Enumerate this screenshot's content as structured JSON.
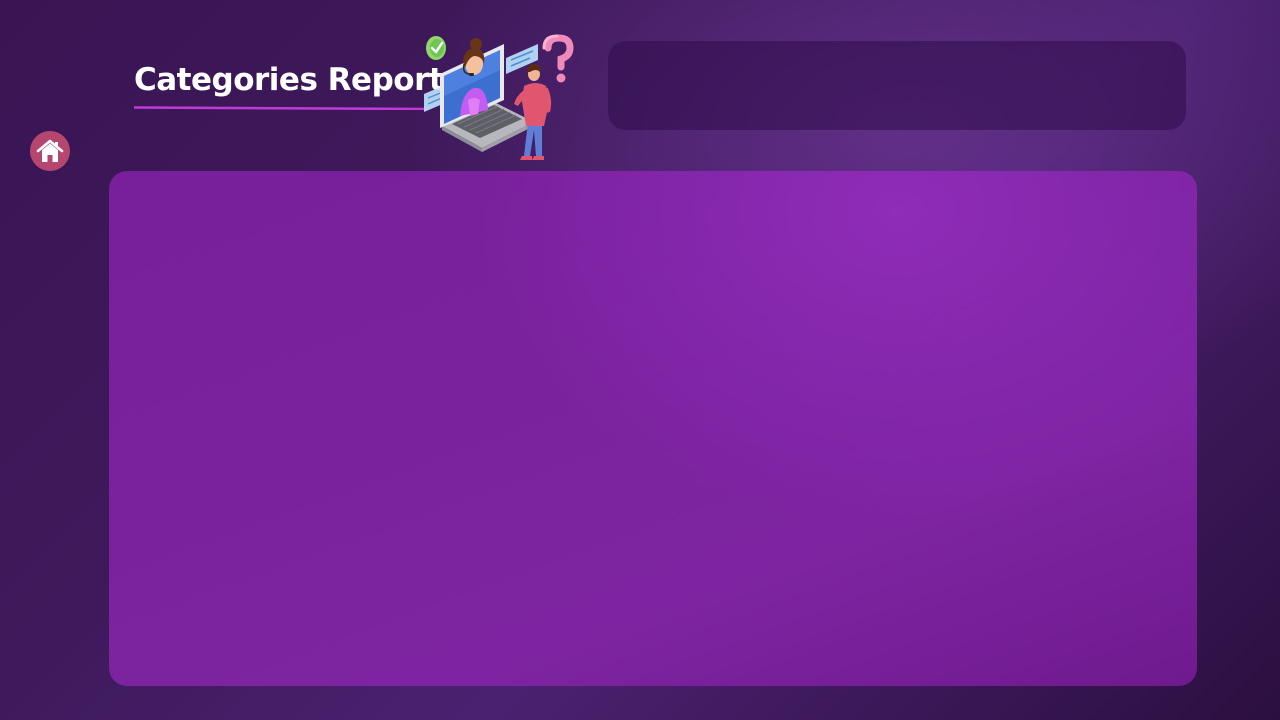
{
  "header": {
    "title": "Categories Report"
  },
  "nav": {
    "home_icon": "home-icon"
  },
  "colors": {
    "accent_underline": "#c13ad8",
    "home_button": "#b5466e",
    "main_panel": "#7e24a2",
    "top_panel": "#3d1660"
  }
}
